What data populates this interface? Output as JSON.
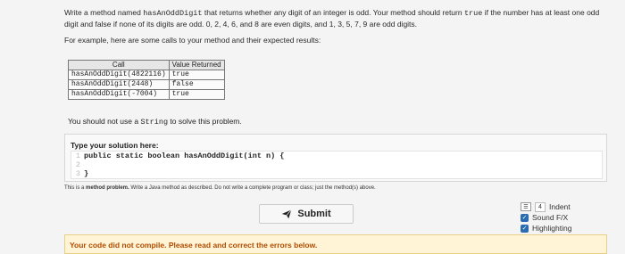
{
  "prompt": {
    "line1a": "Write a method named ",
    "method_name": "hasAnOddDigit",
    "line1b": " that returns whether any digit of an integer is odd. Your method should return ",
    "true_word": "true",
    "line1c": " if the number has at least one odd digit and false if none of its digits are odd. 0, 2, 4, 6, and 8 are even digits, and 1, 3, 5, 7, 9 are odd digits.",
    "line2": "For example, here are some calls to your method and their expected results:"
  },
  "calls_table": {
    "headers": [
      "Call",
      "Value Returned"
    ],
    "rows": [
      [
        "hasAnOddDigit(4822116)",
        "true"
      ],
      [
        "hasAnOddDigit(2448)",
        "false"
      ],
      [
        "hasAnOddDigit(-7004)",
        "true"
      ]
    ]
  },
  "no_string": {
    "a": "You should not use a ",
    "code": "String",
    "b": " to solve this problem."
  },
  "editor": {
    "label": "Type your solution here:",
    "lines": [
      {
        "num": "1",
        "text": "public static boolean hasAnOddDigit(int n) {"
      },
      {
        "num": "2",
        "text": ""
      },
      {
        "num": "3",
        "text": "}"
      }
    ]
  },
  "description": {
    "prefix": "This is a ",
    "bold": "method problem.",
    "rest": " Write a Java method as described. Do not write a complete program or class; just the method(s) above."
  },
  "submit": {
    "label": "Submit"
  },
  "options": {
    "indent_count": "4",
    "indent_label": "Indent",
    "sound_label": "Sound F/X",
    "highlight_label": "Highlighting"
  },
  "error": {
    "message": "Your code did not compile. Please read and correct the errors below."
  }
}
